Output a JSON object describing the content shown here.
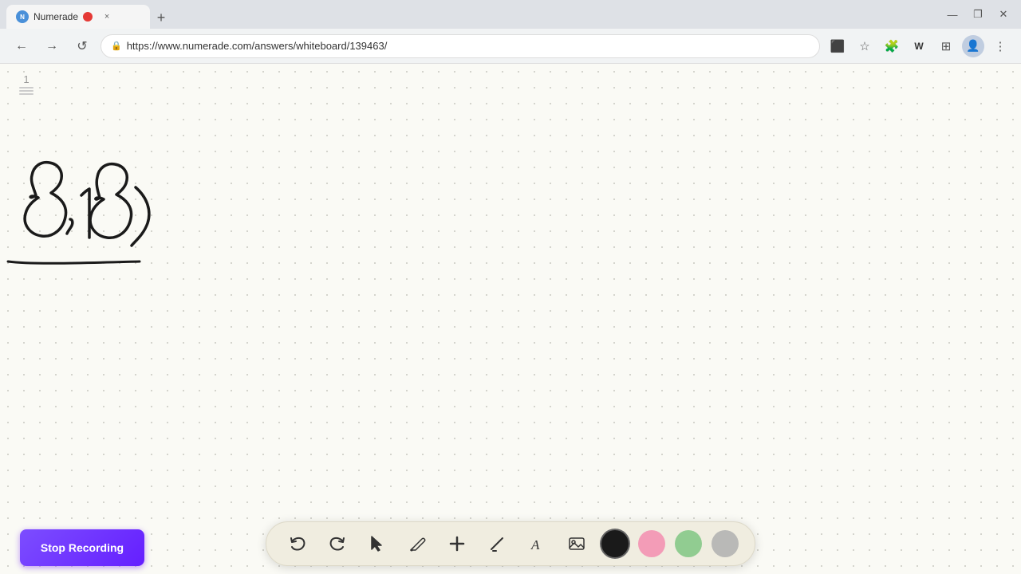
{
  "browser": {
    "tab": {
      "favicon_label": "N",
      "title": "Numerade",
      "close_label": "×",
      "new_tab_label": "+"
    },
    "window_controls": {
      "minimize": "—",
      "maximize": "❐",
      "close": "✕"
    },
    "nav": {
      "back_label": "←",
      "forward_label": "→",
      "refresh_label": "↺",
      "url": "https://www.numerade.com/answers/whiteboard/139463/",
      "menu_label": "⋮"
    }
  },
  "whiteboard": {
    "page_number": "1",
    "content_description": "8,18) handwritten with underline"
  },
  "toolbar": {
    "undo_label": "↺",
    "redo_label": "↻",
    "select_label": "▷",
    "pen_label": "✏",
    "add_label": "+",
    "highlight_label": "/",
    "text_label": "A",
    "image_label": "🖼",
    "colors": {
      "black": "#1a1a1a",
      "pink": "#f48fb1",
      "green": "#81c784",
      "gray": "#b0b0b0"
    }
  },
  "recording": {
    "stop_label": "Stop Recording"
  }
}
